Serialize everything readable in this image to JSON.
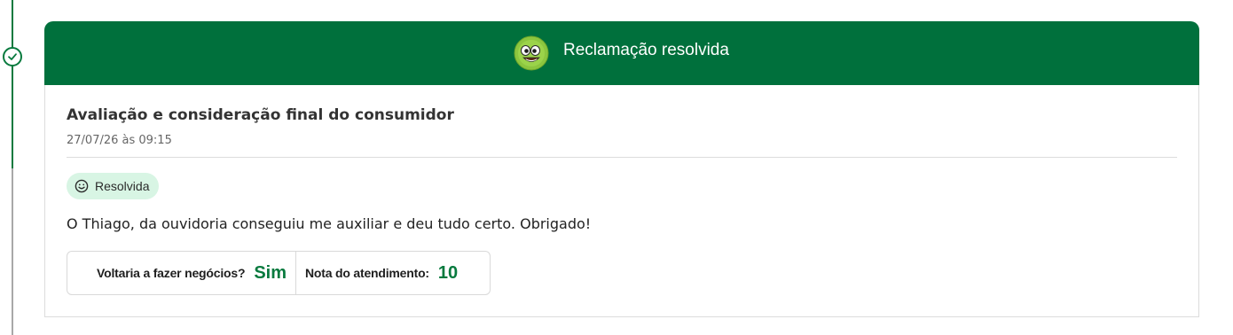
{
  "colors": {
    "brand_green": "#00703c",
    "accent_green": "#087a3e",
    "badge_background": "#d8f5e4",
    "border": "#dcdcdc"
  },
  "timeline": {
    "status_icon": "check-icon"
  },
  "header": {
    "mascot_icon": "smiling-face-mascot-icon",
    "title": "Reclamação resolvida"
  },
  "evaluation": {
    "title": "Avaliação e consideração final do consumidor",
    "timestamp": "27/07/26 às 09:15",
    "status_badge": {
      "icon": "smiley-icon",
      "label": "Resolvida"
    },
    "comment": "O Thiago, da ouvidoria conseguiu me auxiliar e deu tudo certo. Obrigado!",
    "ratings": {
      "would_do_business_again": {
        "label": "Voltaria a fazer negócios?",
        "value": "Sim"
      },
      "service_score": {
        "label": "Nota do atendimento:",
        "value": "10"
      }
    }
  }
}
